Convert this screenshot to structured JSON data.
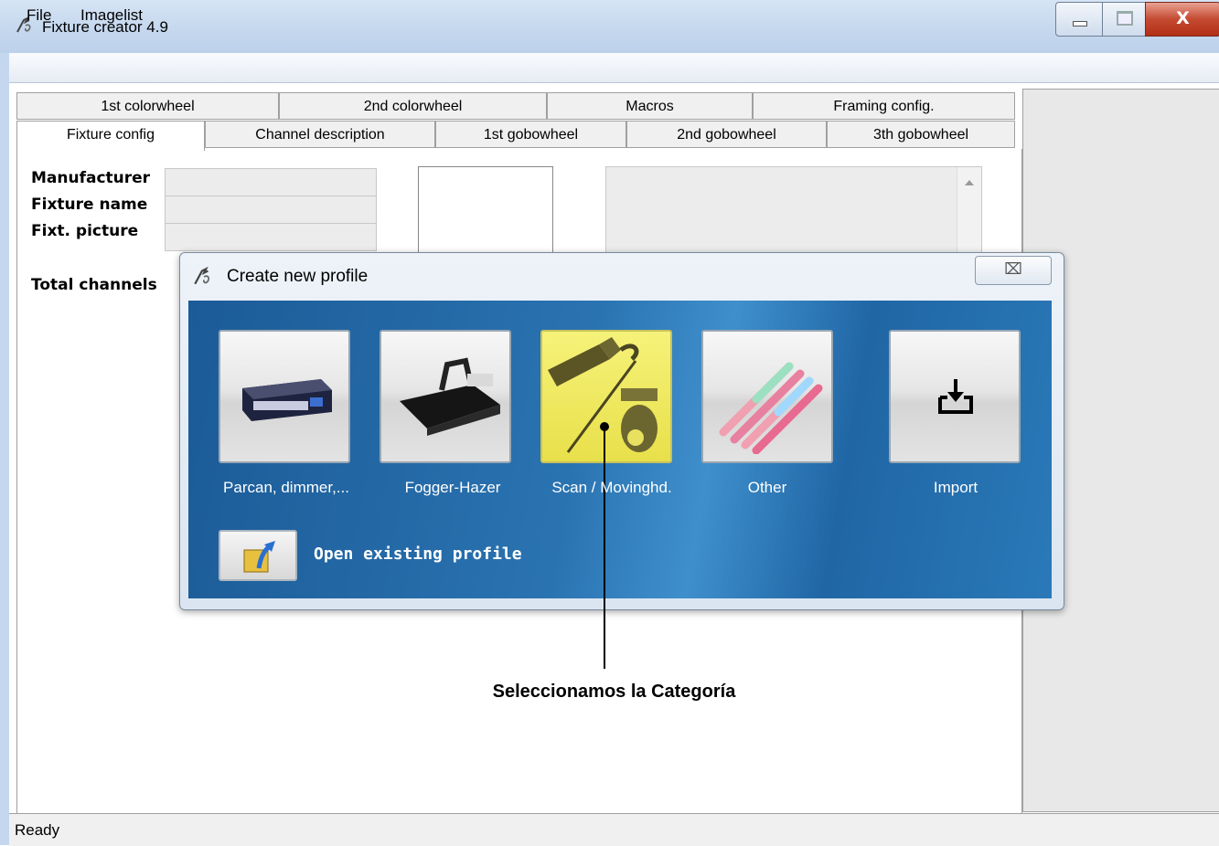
{
  "window": {
    "title": "Fixture creator 4.9",
    "close_glyph": "X"
  },
  "menu": [
    "File",
    "Imagelist"
  ],
  "tabs_back": [
    "1st colorwheel",
    "2nd colorwheel",
    "Macros",
    "Framing config."
  ],
  "tabs_front": [
    "Fixture config",
    "Channel description",
    "1st gobowheel",
    "2nd gobowheel",
    "3th gobowheel"
  ],
  "form": {
    "manufacturer_label": "Manufacturer",
    "fixture_name_label": "Fixture name",
    "fixt_picture_label": "Fixt. picture",
    "total_channels_label": "Total channels"
  },
  "dialog": {
    "title": "Create new profile",
    "close_glyph": "⌧",
    "tiles": [
      {
        "label": "Parcan, dimmer,..."
      },
      {
        "label": "Fogger-Hazer"
      },
      {
        "label": "Scan / Movinghd."
      },
      {
        "label": "Other"
      },
      {
        "label": "Import"
      }
    ],
    "open_existing_label": "Open existing profile"
  },
  "status": {
    "text": "Ready"
  },
  "annotation": {
    "text": "Seleccionamos la Categoría"
  },
  "colors": {
    "dialog_body": "#2a73b1",
    "selected_tile": "#f2ec6a",
    "close_button": "#c44a31"
  }
}
